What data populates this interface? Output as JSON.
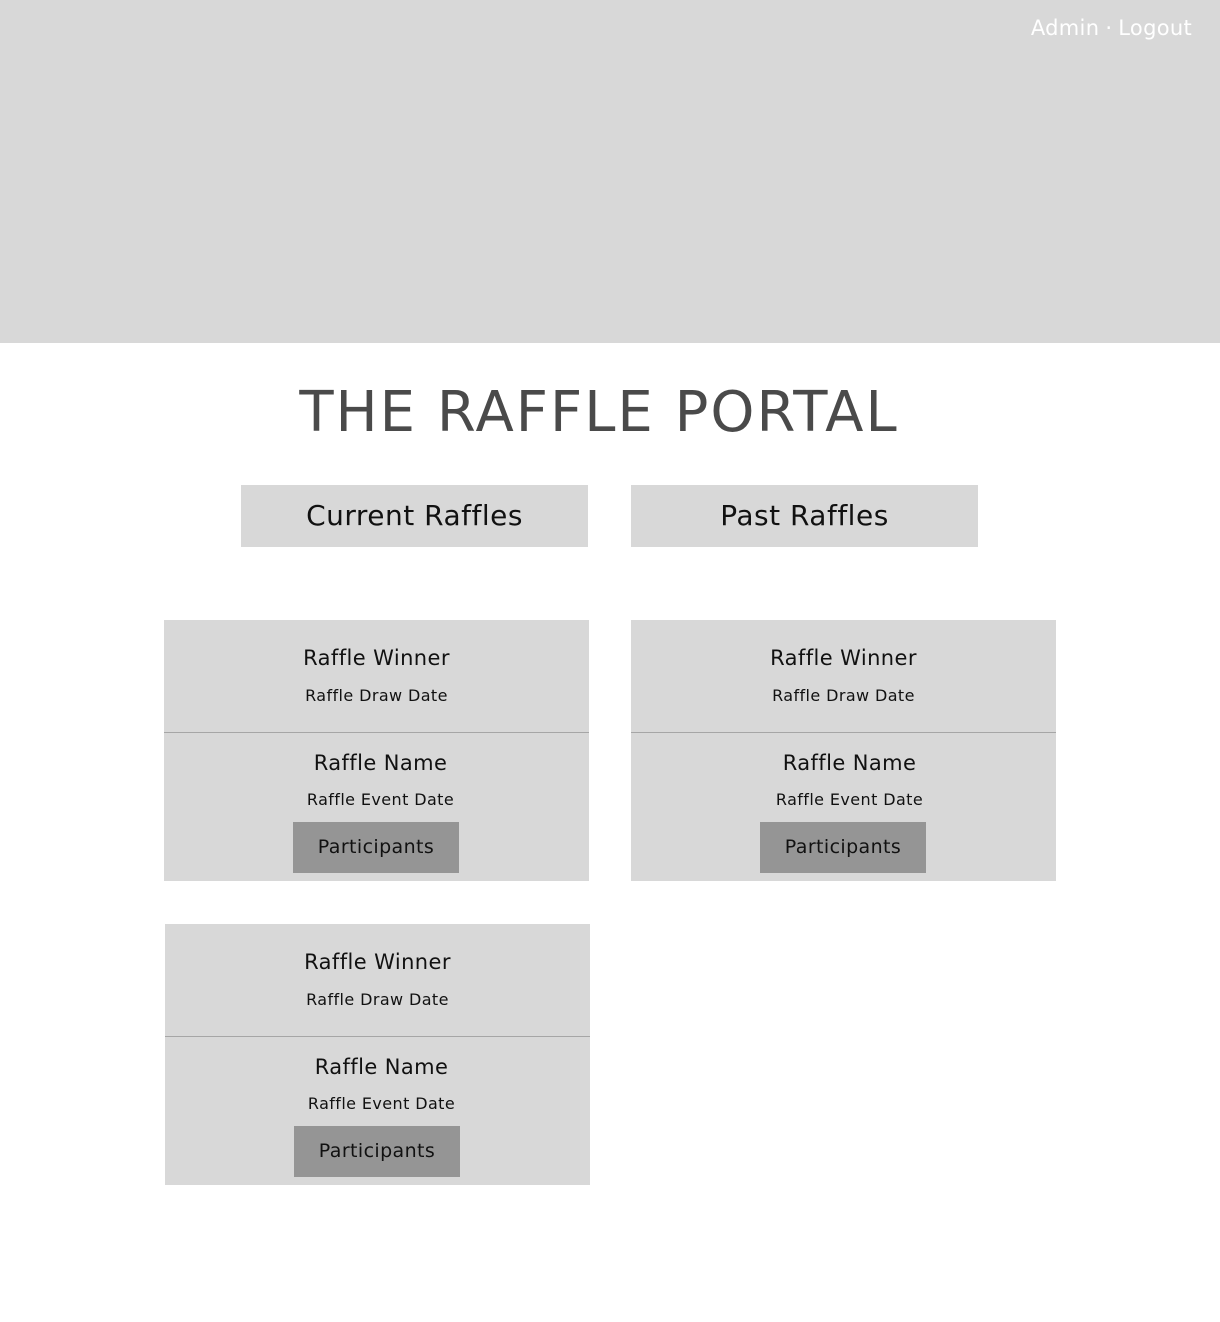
{
  "nav": {
    "admin_label": "Admin",
    "separator": "·",
    "logout_label": "Logout"
  },
  "page_title": "THE RAFFLE PORTAL",
  "tabs": {
    "current_label": "Current Raffles",
    "past_label": "Past Raffles"
  },
  "raffles": [
    {
      "winner": "Raffle Winner",
      "draw_date": "Raffle Draw Date",
      "name": "Raffle Name",
      "event_date": "Raffle Event Date",
      "participants_label": "Participants"
    },
    {
      "winner": "Raffle Winner",
      "draw_date": "Raffle Draw Date",
      "name": "Raffle Name",
      "event_date": "Raffle Event Date",
      "participants_label": "Participants"
    },
    {
      "winner": "Raffle Winner",
      "draw_date": "Raffle Draw Date",
      "name": "Raffle Name",
      "event_date": "Raffle Event Date",
      "participants_label": "Participants"
    }
  ],
  "colors": {
    "hero_background": "#d8d8d8",
    "card_background": "#d8d8d8",
    "button_background": "#959595",
    "title_text": "#4a4a4a",
    "nav_text": "#ffffff"
  }
}
